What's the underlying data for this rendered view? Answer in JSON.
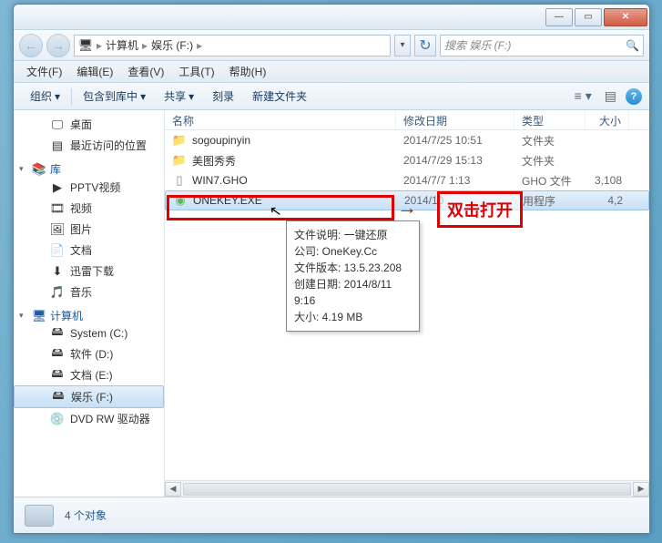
{
  "titlebar": {
    "min": "—",
    "max": "▭",
    "close": "✕"
  },
  "nav": {
    "back": "←",
    "fwd": "→",
    "refresh": "↻"
  },
  "breadcrumb": {
    "icon": "🖥",
    "seg1": "计算机",
    "seg2": "娱乐 (F:)",
    "sep": "▸"
  },
  "search": {
    "placeholder": "搜索 娱乐 (F:)",
    "icon": "🔍"
  },
  "menubar": [
    {
      "label": "文件(F)"
    },
    {
      "label": "编辑(E)"
    },
    {
      "label": "查看(V)"
    },
    {
      "label": "工具(T)"
    },
    {
      "label": "帮助(H)"
    }
  ],
  "toolbar": {
    "organize": "组织",
    "include": "包含到库中",
    "share": "共享",
    "burn": "刻录",
    "newfolder": "新建文件夹",
    "tri": "▾",
    "help": "?"
  },
  "sidebar": {
    "desktop": "桌面",
    "recent": "最近访问的位置",
    "libraries": "库",
    "pptv": "PPTV视频",
    "videos": "视频",
    "pictures": "图片",
    "documents": "文档",
    "xunlei": "迅雷下载",
    "music": "音乐",
    "computer": "计算机",
    "cdrive": "System (C:)",
    "ddrive": "软件 (D:)",
    "edrive": "文档 (E:)",
    "fdrive": "娱乐 (F:)",
    "dvd": "DVD RW 驱动器"
  },
  "columns": {
    "name": "名称",
    "date": "修改日期",
    "type": "类型",
    "size": "大小"
  },
  "files": [
    {
      "icon": "📁",
      "iconClass": "folder-icon",
      "name": "sogoupinyin",
      "date": "2014/7/25 10:51",
      "type": "文件夹",
      "size": ""
    },
    {
      "icon": "📁",
      "iconClass": "folder-icon",
      "name": "美图秀秀",
      "date": "2014/7/29 15:13",
      "type": "文件夹",
      "size": ""
    },
    {
      "icon": "▯",
      "iconClass": "file-icon",
      "name": "WIN7.GHO",
      "date": "2014/7/7 1:13",
      "type": "GHO 文件",
      "size": "3,108"
    },
    {
      "icon": "◉",
      "iconClass": "exe-icon",
      "name": "ONEKEY.EXE",
      "date": "2014/10",
      "type": "用程序",
      "size": "4,2"
    }
  ],
  "tooltip": {
    "l1": "文件说明: 一键还原",
    "l2": "公司: OneKey.Cc",
    "l3": "文件版本: 13.5.23.208",
    "l4": "创建日期: 2014/8/11 9:16",
    "l5": "大小: 4.19 MB"
  },
  "annotation": {
    "label": "双击打开",
    "arrow": "→"
  },
  "statusbar": {
    "count": "4 个对象"
  }
}
